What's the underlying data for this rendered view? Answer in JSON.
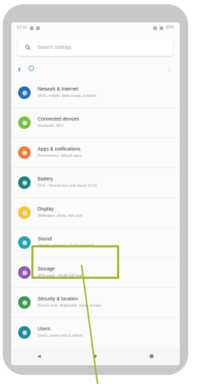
{
  "colors": {
    "accent": "#a6b623",
    "phone_frame": "#c7c9c8",
    "back_arrow": "#1d5e9c"
  },
  "status_bar": {
    "left_text": "10:12",
    "right_text": "85%"
  },
  "search": {
    "placeholder": "Search settings",
    "icon": "search-icon"
  },
  "toolbar": {
    "back_icon": "‹",
    "overflow_icon": "⋮"
  },
  "settings_items": [
    {
      "title": "Network & Internet",
      "subtitle": "Wi-Fi, mobile, data usage, hotspot",
      "color": "#1f6fb3",
      "icon": "wifi-icon"
    },
    {
      "title": "Connected devices",
      "subtitle": "Bluetooth, NFC",
      "color": "#7bbf3f",
      "icon": "devices-icon"
    },
    {
      "title": "Apps & notifications",
      "subtitle": "Permissions, default apps",
      "color": "#f07a34",
      "icon": "apps-icon"
    },
    {
      "title": "Battery",
      "subtitle": "51% - Should last until about 10:15",
      "color": "#16827e",
      "icon": "battery-icon"
    },
    {
      "title": "Display",
      "subtitle": "Wallpaper, sleep, font size",
      "color": "#f4c530",
      "icon": "display-icon"
    },
    {
      "title": "Sound",
      "subtitle": "Volume, vibration, Do Not Disturb",
      "color": "#239fae",
      "icon": "sound-icon"
    },
    {
      "title": "Storage",
      "subtitle": "35% used - 20.88 GB free",
      "color": "#8f57b8",
      "icon": "storage-icon"
    },
    {
      "title": "Security & location",
      "subtitle": "Screen lock, fingerprint, Sync, private",
      "color": "#3a9a55",
      "icon": "security-icon"
    },
    {
      "title": "Users",
      "subtitle": "Users, owner info & others",
      "color": "#1d8a9a",
      "icon": "user-icon"
    }
  ],
  "navbar": {
    "back": "◂",
    "home": "●",
    "recents": "■"
  }
}
